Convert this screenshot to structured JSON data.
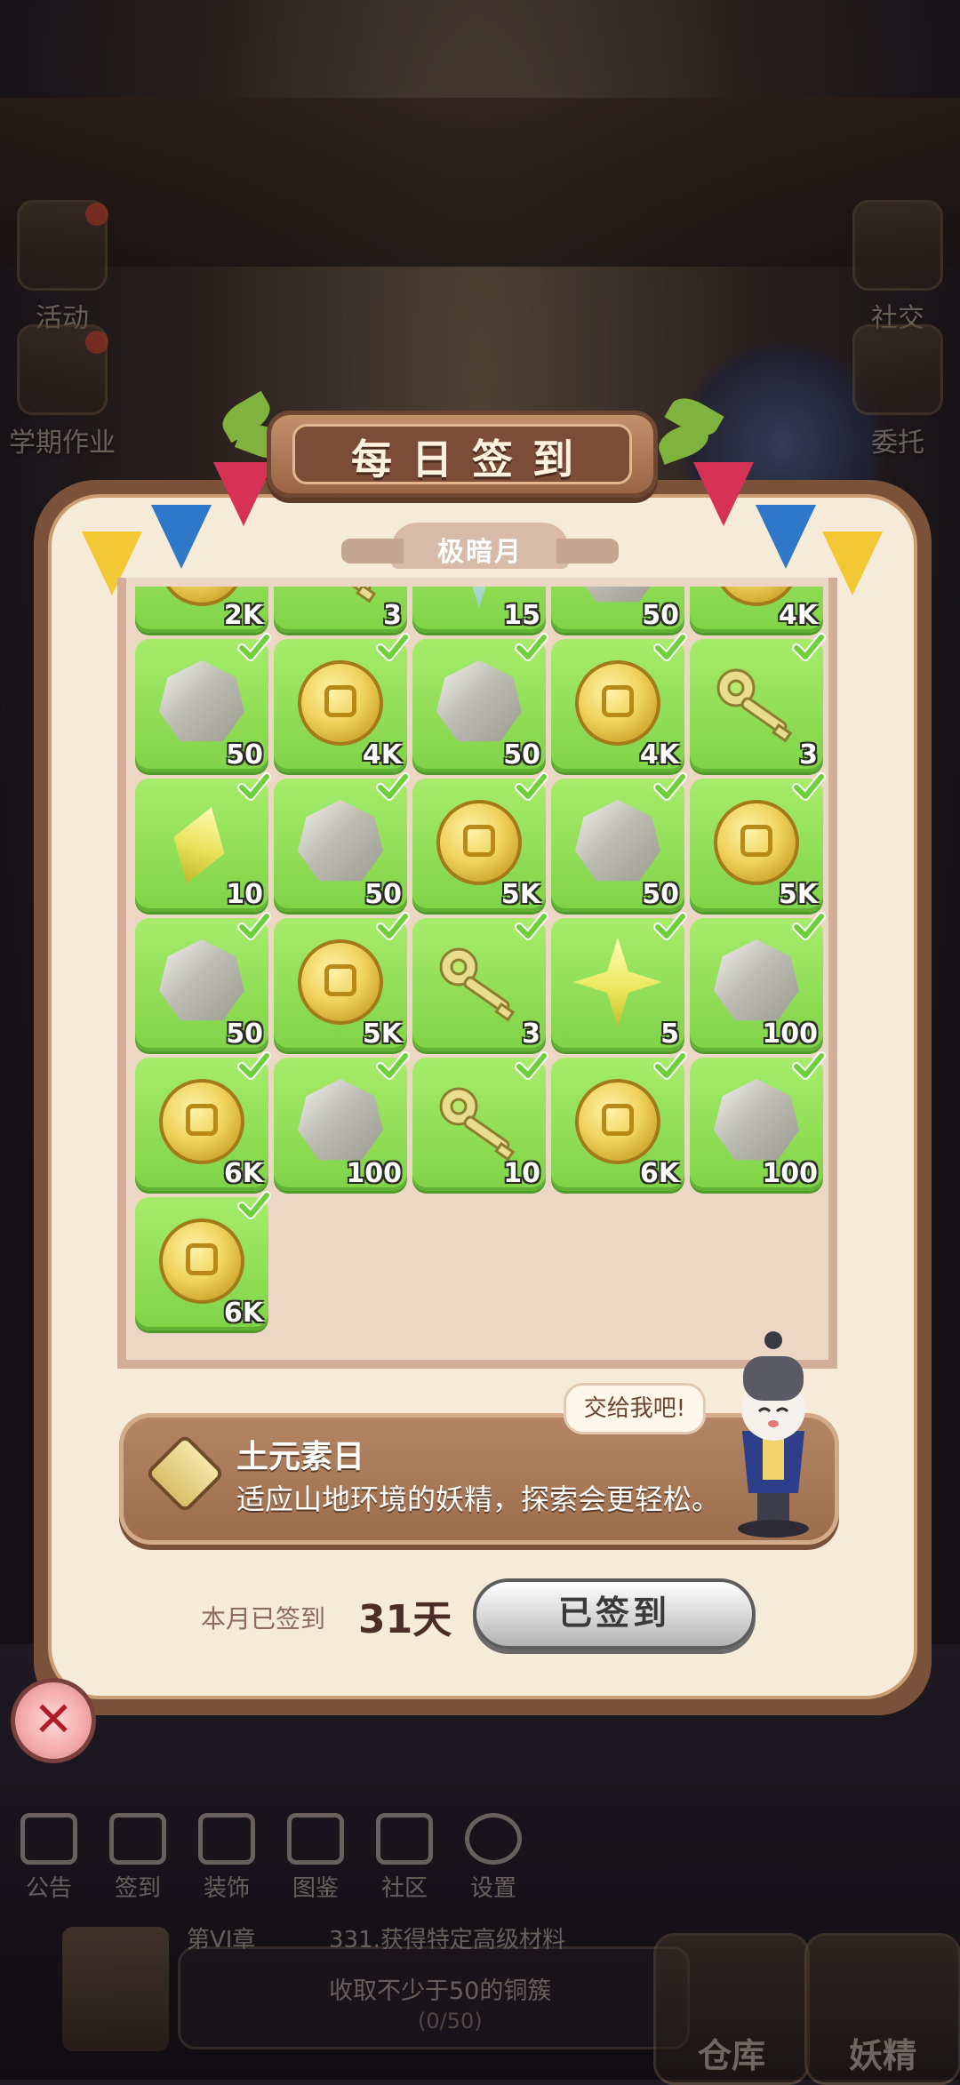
{
  "side_left": [
    {
      "label": "活动"
    },
    {
      "label": "学期作业"
    }
  ],
  "side_right": [
    {
      "label": "社交"
    },
    {
      "label": "委托"
    }
  ],
  "dialog": {
    "title": "每日签到",
    "month": "极暗月"
  },
  "calendar": {
    "cells": [
      {
        "item": "coin-icon",
        "amount": "2K",
        "checked": true
      },
      {
        "item": "key-icon",
        "amount": "3",
        "checked": true
      },
      {
        "item": "star-icon",
        "amount": "15",
        "checked": true
      },
      {
        "item": "gem-icon",
        "amount": "50",
        "checked": true
      },
      {
        "item": "coin-icon",
        "amount": "4K",
        "checked": true
      },
      {
        "item": "gem-icon",
        "amount": "50",
        "checked": true
      },
      {
        "item": "coin-icon",
        "amount": "4K",
        "checked": true
      },
      {
        "item": "gem-icon",
        "amount": "50",
        "checked": true
      },
      {
        "item": "coin-icon",
        "amount": "4K",
        "checked": true
      },
      {
        "item": "key-icon",
        "amount": "3",
        "checked": true
      },
      {
        "item": "diamond-icon",
        "amount": "10",
        "checked": true
      },
      {
        "item": "gem-icon",
        "amount": "50",
        "checked": true
      },
      {
        "item": "coin-icon",
        "amount": "5K",
        "checked": true
      },
      {
        "item": "gem-icon",
        "amount": "50",
        "checked": true
      },
      {
        "item": "coin-icon",
        "amount": "5K",
        "checked": true
      },
      {
        "item": "gem-icon",
        "amount": "50",
        "checked": true
      },
      {
        "item": "coin-icon",
        "amount": "5K",
        "checked": true
      },
      {
        "item": "key-icon",
        "amount": "3",
        "checked": true
      },
      {
        "item": "star-icon",
        "amount": "5",
        "checked": true
      },
      {
        "item": "gem-icon",
        "amount": "100",
        "checked": true
      },
      {
        "item": "coin-icon",
        "amount": "6K",
        "checked": true
      },
      {
        "item": "gem-icon",
        "amount": "100",
        "checked": true
      },
      {
        "item": "key-icon",
        "amount": "10",
        "checked": true
      },
      {
        "item": "coin-icon",
        "amount": "6K",
        "checked": true
      },
      {
        "item": "gem-icon",
        "amount": "100",
        "checked": true
      },
      {
        "item": "coin-icon",
        "amount": "6K",
        "checked": true
      }
    ]
  },
  "element_day": {
    "title": "土元素日",
    "description": "适应山地环境的妖精，探索会更轻松。"
  },
  "mascot_speech": "交给我吧!",
  "signin": {
    "label": "本月已签到",
    "days": "31天",
    "button": "已签到"
  },
  "bottom_nav": [
    {
      "label": "公告"
    },
    {
      "label": "签到"
    },
    {
      "label": "装饰"
    },
    {
      "label": "图鉴"
    },
    {
      "label": "社区"
    },
    {
      "label": "设置"
    }
  ],
  "quest": {
    "chapter": "第VI章",
    "task": "331.获得特定高级材料",
    "requirement": "收取不少于50的铜簇",
    "progress": "(0/50)"
  },
  "corner_buttons": {
    "warehouse": "仓库",
    "fairy": "妖精"
  },
  "colors": {
    "cell_green": "#8fdc52",
    "panel_cream": "#f6ead8",
    "frame_brown": "#7a523a",
    "check_green": "#6fcf3a"
  }
}
